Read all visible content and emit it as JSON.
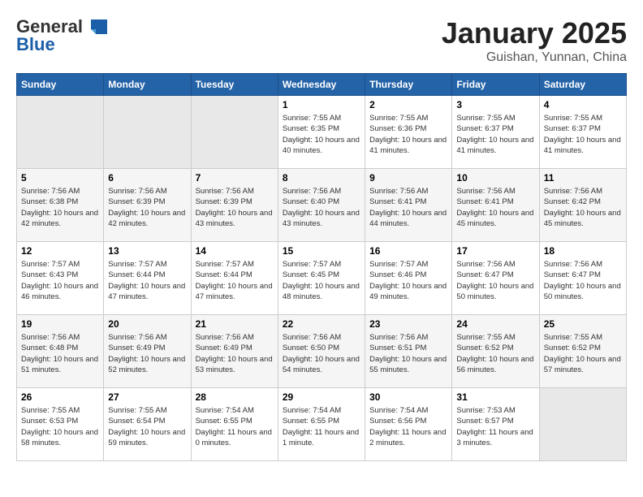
{
  "header": {
    "logo_general": "General",
    "logo_blue": "Blue",
    "month_title": "January 2025",
    "location": "Guishan, Yunnan, China"
  },
  "days_of_week": [
    "Sunday",
    "Monday",
    "Tuesday",
    "Wednesday",
    "Thursday",
    "Friday",
    "Saturday"
  ],
  "weeks": [
    {
      "days": [
        {
          "num": "",
          "empty": true
        },
        {
          "num": "",
          "empty": true
        },
        {
          "num": "",
          "empty": true
        },
        {
          "num": "1",
          "sunrise": "7:55 AM",
          "sunset": "6:35 PM",
          "daylight": "10 hours and 40 minutes."
        },
        {
          "num": "2",
          "sunrise": "7:55 AM",
          "sunset": "6:36 PM",
          "daylight": "10 hours and 41 minutes."
        },
        {
          "num": "3",
          "sunrise": "7:55 AM",
          "sunset": "6:37 PM",
          "daylight": "10 hours and 41 minutes."
        },
        {
          "num": "4",
          "sunrise": "7:55 AM",
          "sunset": "6:37 PM",
          "daylight": "10 hours and 41 minutes."
        }
      ]
    },
    {
      "days": [
        {
          "num": "5",
          "sunrise": "7:56 AM",
          "sunset": "6:38 PM",
          "daylight": "10 hours and 42 minutes."
        },
        {
          "num": "6",
          "sunrise": "7:56 AM",
          "sunset": "6:39 PM",
          "daylight": "10 hours and 42 minutes."
        },
        {
          "num": "7",
          "sunrise": "7:56 AM",
          "sunset": "6:39 PM",
          "daylight": "10 hours and 43 minutes."
        },
        {
          "num": "8",
          "sunrise": "7:56 AM",
          "sunset": "6:40 PM",
          "daylight": "10 hours and 43 minutes."
        },
        {
          "num": "9",
          "sunrise": "7:56 AM",
          "sunset": "6:41 PM",
          "daylight": "10 hours and 44 minutes."
        },
        {
          "num": "10",
          "sunrise": "7:56 AM",
          "sunset": "6:41 PM",
          "daylight": "10 hours and 45 minutes."
        },
        {
          "num": "11",
          "sunrise": "7:56 AM",
          "sunset": "6:42 PM",
          "daylight": "10 hours and 45 minutes."
        }
      ]
    },
    {
      "days": [
        {
          "num": "12",
          "sunrise": "7:57 AM",
          "sunset": "6:43 PM",
          "daylight": "10 hours and 46 minutes."
        },
        {
          "num": "13",
          "sunrise": "7:57 AM",
          "sunset": "6:44 PM",
          "daylight": "10 hours and 47 minutes."
        },
        {
          "num": "14",
          "sunrise": "7:57 AM",
          "sunset": "6:44 PM",
          "daylight": "10 hours and 47 minutes."
        },
        {
          "num": "15",
          "sunrise": "7:57 AM",
          "sunset": "6:45 PM",
          "daylight": "10 hours and 48 minutes."
        },
        {
          "num": "16",
          "sunrise": "7:57 AM",
          "sunset": "6:46 PM",
          "daylight": "10 hours and 49 minutes."
        },
        {
          "num": "17",
          "sunrise": "7:56 AM",
          "sunset": "6:47 PM",
          "daylight": "10 hours and 50 minutes."
        },
        {
          "num": "18",
          "sunrise": "7:56 AM",
          "sunset": "6:47 PM",
          "daylight": "10 hours and 50 minutes."
        }
      ]
    },
    {
      "days": [
        {
          "num": "19",
          "sunrise": "7:56 AM",
          "sunset": "6:48 PM",
          "daylight": "10 hours and 51 minutes."
        },
        {
          "num": "20",
          "sunrise": "7:56 AM",
          "sunset": "6:49 PM",
          "daylight": "10 hours and 52 minutes."
        },
        {
          "num": "21",
          "sunrise": "7:56 AM",
          "sunset": "6:49 PM",
          "daylight": "10 hours and 53 minutes."
        },
        {
          "num": "22",
          "sunrise": "7:56 AM",
          "sunset": "6:50 PM",
          "daylight": "10 hours and 54 minutes."
        },
        {
          "num": "23",
          "sunrise": "7:56 AM",
          "sunset": "6:51 PM",
          "daylight": "10 hours and 55 minutes."
        },
        {
          "num": "24",
          "sunrise": "7:55 AM",
          "sunset": "6:52 PM",
          "daylight": "10 hours and 56 minutes."
        },
        {
          "num": "25",
          "sunrise": "7:55 AM",
          "sunset": "6:52 PM",
          "daylight": "10 hours and 57 minutes."
        }
      ]
    },
    {
      "days": [
        {
          "num": "26",
          "sunrise": "7:55 AM",
          "sunset": "6:53 PM",
          "daylight": "10 hours and 58 minutes."
        },
        {
          "num": "27",
          "sunrise": "7:55 AM",
          "sunset": "6:54 PM",
          "daylight": "10 hours and 59 minutes."
        },
        {
          "num": "28",
          "sunrise": "7:54 AM",
          "sunset": "6:55 PM",
          "daylight": "11 hours and 0 minutes."
        },
        {
          "num": "29",
          "sunrise": "7:54 AM",
          "sunset": "6:55 PM",
          "daylight": "11 hours and 1 minute."
        },
        {
          "num": "30",
          "sunrise": "7:54 AM",
          "sunset": "6:56 PM",
          "daylight": "11 hours and 2 minutes."
        },
        {
          "num": "31",
          "sunrise": "7:53 AM",
          "sunset": "6:57 PM",
          "daylight": "11 hours and 3 minutes."
        },
        {
          "num": "",
          "empty": true
        }
      ]
    }
  ],
  "labels": {
    "sunrise": "Sunrise:",
    "sunset": "Sunset:",
    "daylight": "Daylight:"
  }
}
